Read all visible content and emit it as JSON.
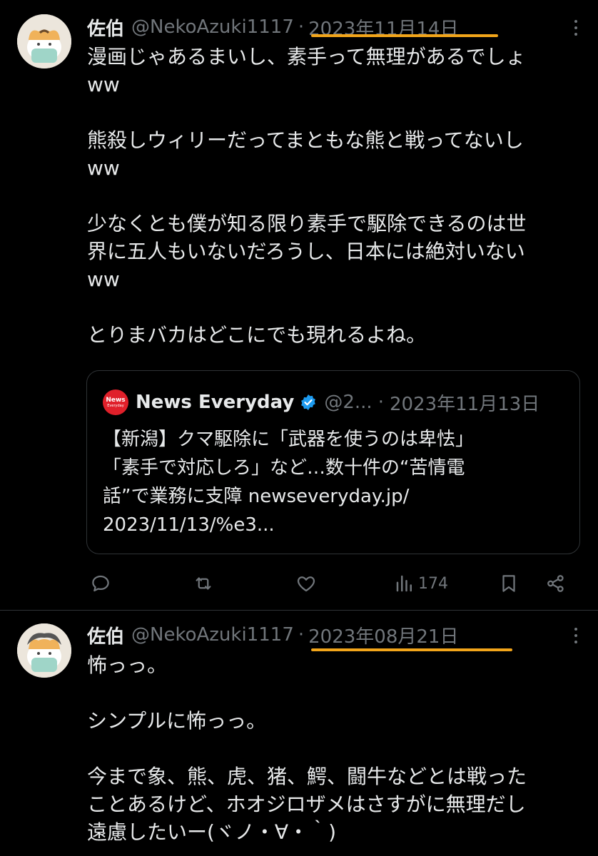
{
  "tweets": [
    {
      "name": "佐伯",
      "handle": "@NekoAzuki1117",
      "separator": "·",
      "date": "2023年11月14日",
      "lines": [
        "漫画じゃあるまいし、素手って無理があるでしょ",
        "ww",
        "",
        "熊殺しウィリーだってまともな熊と戦ってないし",
        "ww",
        "",
        "少なくとも僕が知る限り素手で駆除できるのは世",
        "界に五人もいないだろうし、日本には絶対いない",
        "ww",
        "",
        "とりまバカはどこにでも現れるよね。"
      ],
      "quote": {
        "logo_text": "News",
        "logo_subtext": "Everyday",
        "name": "News Everyday",
        "handle": "@2...",
        "separator": "·",
        "date": "2023年11月13日",
        "lines": [
          "【新潟】クマ駆除に「武器を使うのは卑怯」",
          "「素手で対応しろ」など…数十件の“苦情電",
          "話”で業務に支障 newseveryday.jp/",
          "2023/11/13/%e3..."
        ]
      },
      "actions": {
        "reply": "",
        "retweet": "",
        "like": "",
        "views": "174"
      }
    },
    {
      "name": "佐伯",
      "handle": "@NekoAzuki1117",
      "separator": "·",
      "date": "2023年08月21日",
      "lines": [
        "怖っっ。",
        "",
        "シンプルに怖っっ。",
        "",
        "今まで象、熊、虎、猪、鰐、闘牛などとは戦った",
        "ことあるけど、ホオジロザメはさすがに無理だし",
        "遠慮したいー(ヾノ・∀・｀)"
      ]
    }
  ],
  "colors": {
    "background": "#000000",
    "text": "#e7e9ea",
    "muted": "#71767b",
    "highlight_underline": "#f2a51a",
    "verified": "#1d9bf0",
    "news_logo": "#e0202a"
  },
  "icons": {
    "reply": "reply-icon",
    "retweet": "retweet-icon",
    "like": "heart-icon",
    "views": "views-chart-icon",
    "bookmark": "bookmark-icon",
    "share": "share-icon",
    "more": "more-icon"
  }
}
